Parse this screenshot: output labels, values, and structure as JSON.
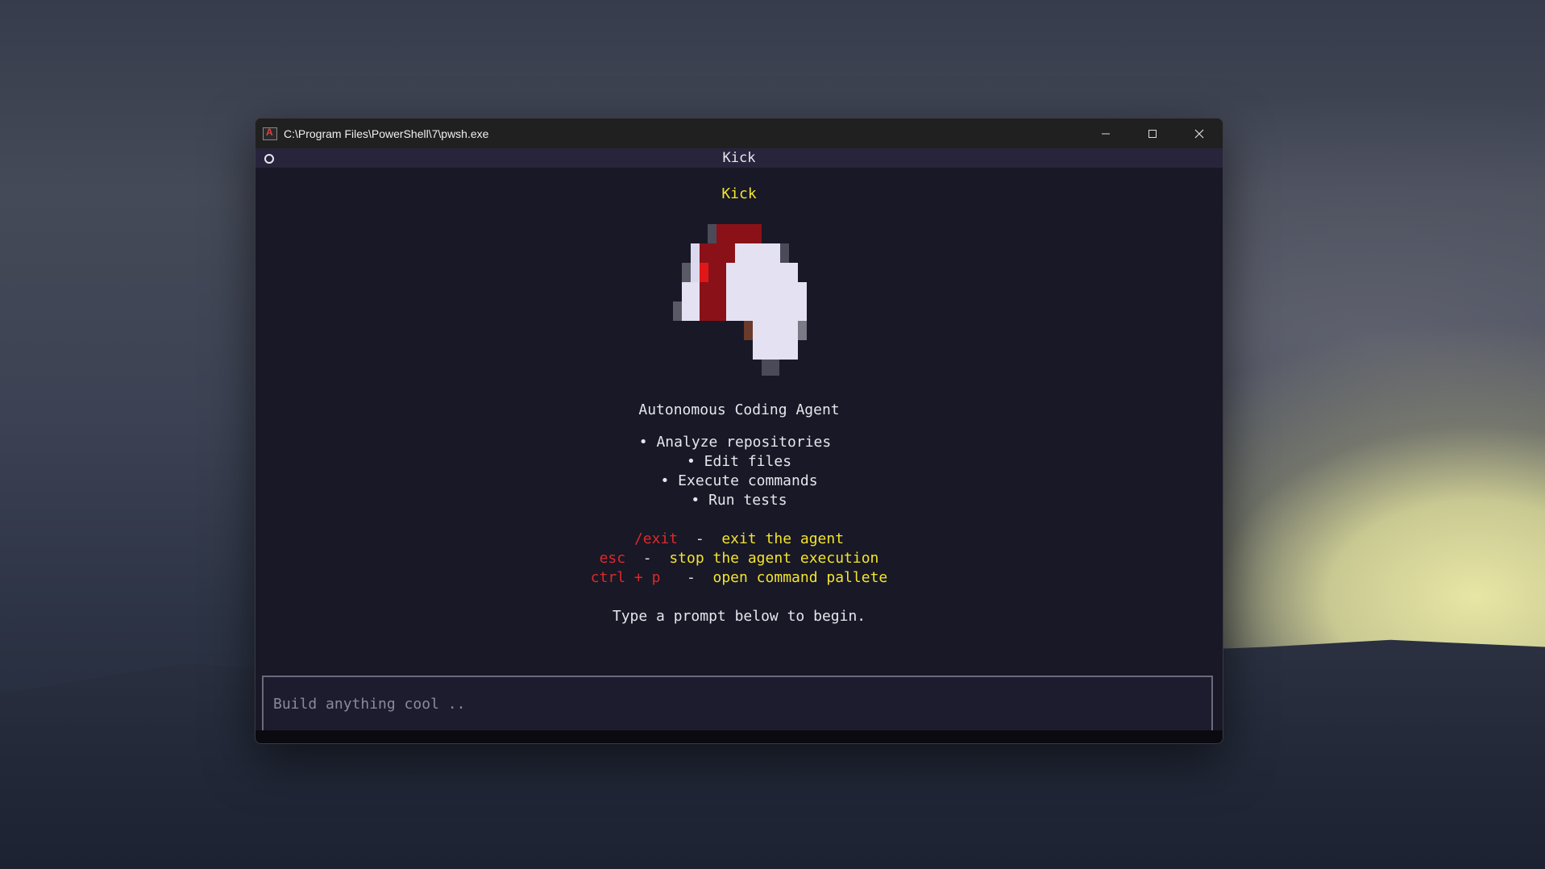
{
  "window": {
    "title": "C:\\Program Files\\PowerShell\\7\\pwsh.exe",
    "app_icon": "powershell-app-icon",
    "controls": [
      "minimize-icon",
      "maximize-icon",
      "close-icon"
    ]
  },
  "tab": {
    "title": "Kick",
    "status_icon": "circle-icon"
  },
  "welcome": {
    "brand": "Kick",
    "logo_icon": "pixel-art-brain-icon",
    "subtitle": "Autonomous Coding Agent",
    "features": [
      "Analyze repositories",
      "Edit files",
      "Execute commands",
      "Run tests"
    ],
    "bullet": "•",
    "shortcuts": [
      {
        "key": "/exit",
        "sep": "-",
        "desc": "exit the agent"
      },
      {
        "key": "esc",
        "sep": "-",
        "desc": "stop the agent execution"
      },
      {
        "key": "ctrl + p",
        "sep": "-",
        "desc": "open command pallete"
      }
    ],
    "hint": "Type a prompt below to begin."
  },
  "prompt": {
    "placeholder": "Build anything cool ..",
    "value": ""
  },
  "colors": {
    "brand_yellow": "#f2e430",
    "key_red": "#e0282a",
    "terminal_bg": "#181826",
    "tab_bg": "#28243c"
  }
}
